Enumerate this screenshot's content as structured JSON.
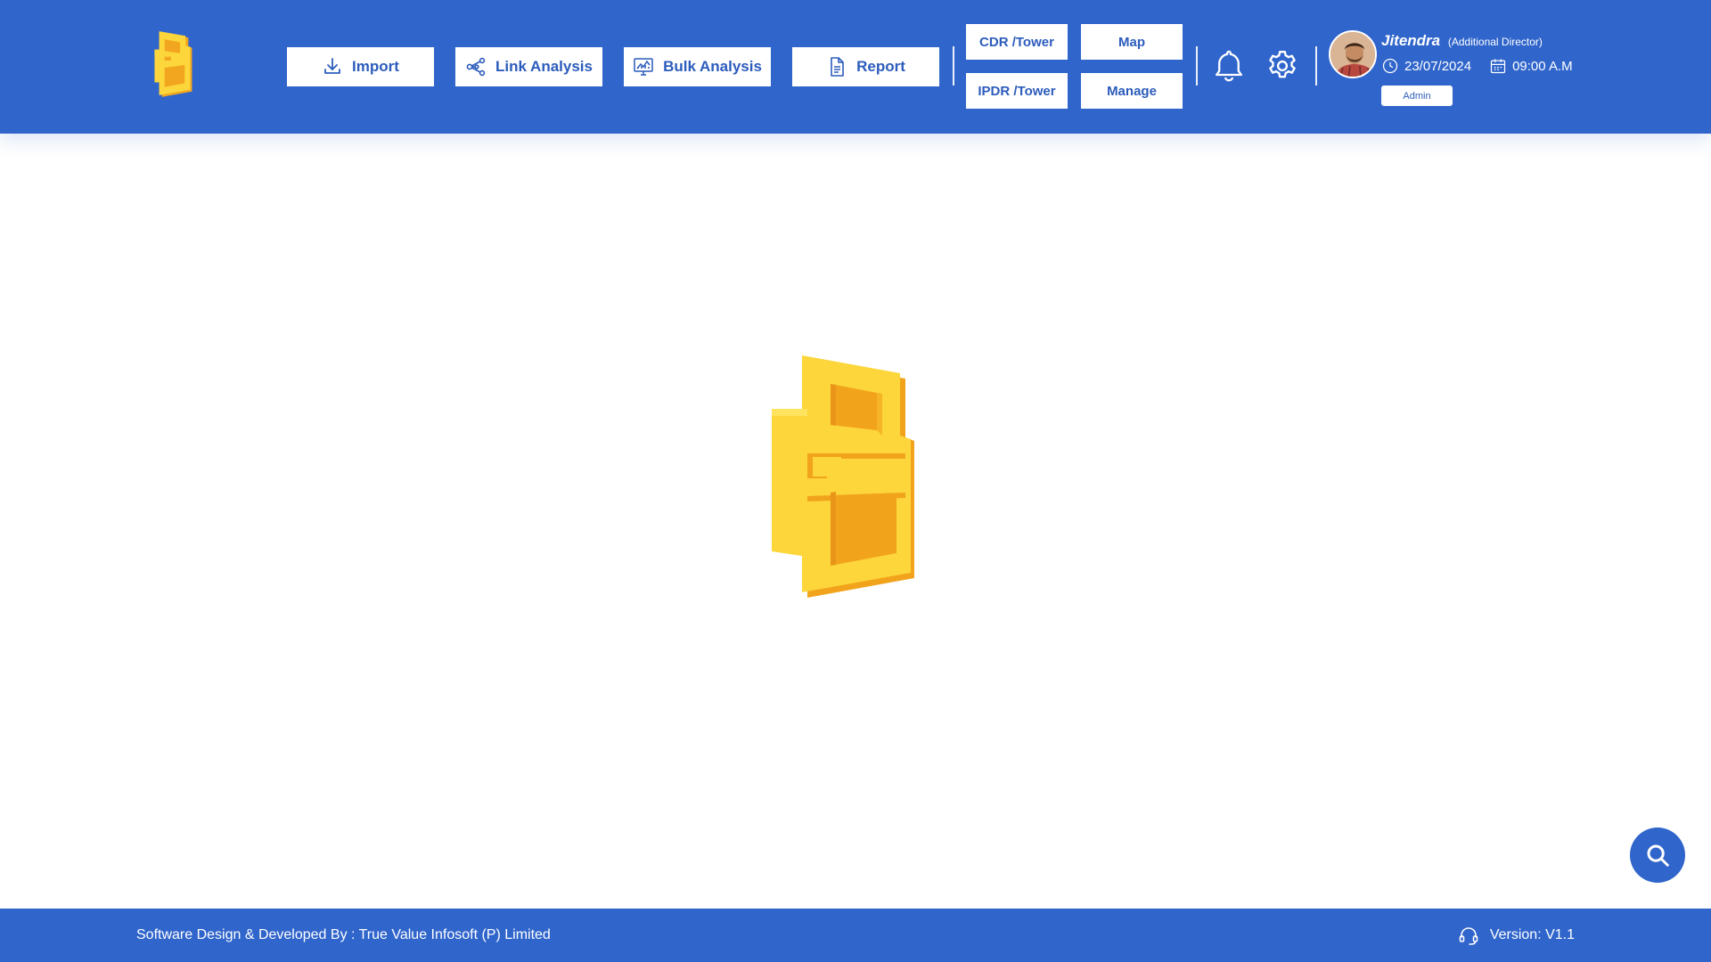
{
  "header": {
    "nav": [
      {
        "label": "Import",
        "icon": "download-icon"
      },
      {
        "label": "Link Analysis",
        "icon": "share-nodes-icon"
      },
      {
        "label": "Bulk Analysis",
        "icon": "chart-monitor-icon"
      },
      {
        "label": "Report",
        "icon": "document-icon"
      }
    ],
    "quick_links": {
      "cdr_tower": "CDR /Tower",
      "ipdr_tower": "IPDR /Tower",
      "map": "Map",
      "manage": "Manage"
    },
    "icons": {
      "notifications": "bell-icon",
      "settings": "gear-icon"
    },
    "user": {
      "name": "Jitendra",
      "role": "(Additional Director)",
      "date": "23/07/2024",
      "time": "09:00 A.M",
      "badge": "Admin"
    }
  },
  "footer": {
    "credit": "Software Design & Developed By : True Value Infosoft (P) Limited",
    "version": "Version: V1.1"
  },
  "colors": {
    "primary": "#3065cb",
    "logo_yellow": "#fcd63a",
    "logo_shade": "#f1a51f",
    "button_text": "#2c5cbc"
  }
}
